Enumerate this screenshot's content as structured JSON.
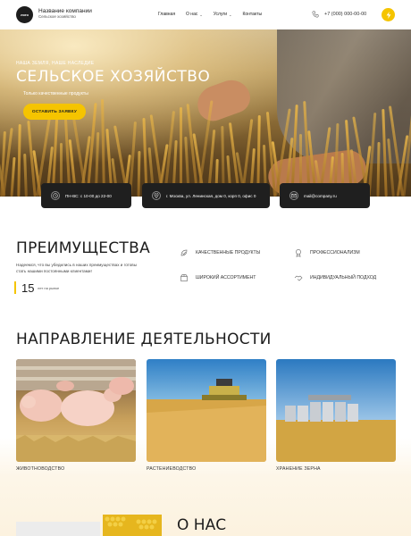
{
  "header": {
    "logo_text": "лого",
    "company_name": "Название компании",
    "company_sub": "Сельское хозяйство",
    "nav": [
      {
        "label": "Главная",
        "has_dropdown": false
      },
      {
        "label": "О нас",
        "has_dropdown": true
      },
      {
        "label": "Услуги",
        "has_dropdown": true
      },
      {
        "label": "Контакты",
        "has_dropdown": false
      }
    ],
    "phone": "+7 (000) 000-00-00"
  },
  "hero": {
    "overline": "НАША ЗЕМЛЯ, НАШЕ НАСЛЕДИЕ",
    "title": "СЕЛЬСКОЕ ХОЗЯЙСТВО",
    "tagline": "Только качественные продукты",
    "button": "ОСТАВИТЬ ЗАЯВКУ"
  },
  "info": [
    {
      "icon": "clock-icon",
      "text": "ПН-ВС: с 10-00 до 22-00"
    },
    {
      "icon": "location-pin-icon",
      "text": "г. Москва, ул. Ленинская, дом 0, корп 0, офис 0"
    },
    {
      "icon": "mail-icon",
      "text": "mail@company.ru"
    }
  ],
  "advantages": {
    "title": "ПРЕИМУЩЕСТВА",
    "description": "Надеемся, что вы убедились в наших преимуществах и готовы стать нашими постоянными клиентами!",
    "years_number": "15",
    "years_label": "лет на рынке",
    "features": [
      {
        "icon": "leaf-check-icon",
        "label": "КАЧЕСТВЕННЫЕ ПРОДУКТЫ"
      },
      {
        "icon": "badge-icon",
        "label": "ПРОФЕССИОНАЛИЗМ"
      },
      {
        "icon": "box-icon",
        "label": "ШИРОКИЙ АССОРТИМЕНТ"
      },
      {
        "icon": "handshake-icon",
        "label": "ИНДИВИДУАЛЬНЫЙ ПОДХОД"
      }
    ]
  },
  "directions": {
    "title": "НАПРАВЛЕНИЕ ДЕЯТЕЛЬНОСТИ",
    "cards": [
      {
        "label": "ЖИВОТНОВОДСТВО"
      },
      {
        "label": "РАСТЕНИЕВОДСТВО"
      },
      {
        "label": "ХРАНЕНИЕ ЗЕРНА"
      }
    ]
  },
  "about": {
    "title": "О НАС"
  },
  "colors": {
    "accent": "#f5c400",
    "dark": "#1f1f1f"
  }
}
